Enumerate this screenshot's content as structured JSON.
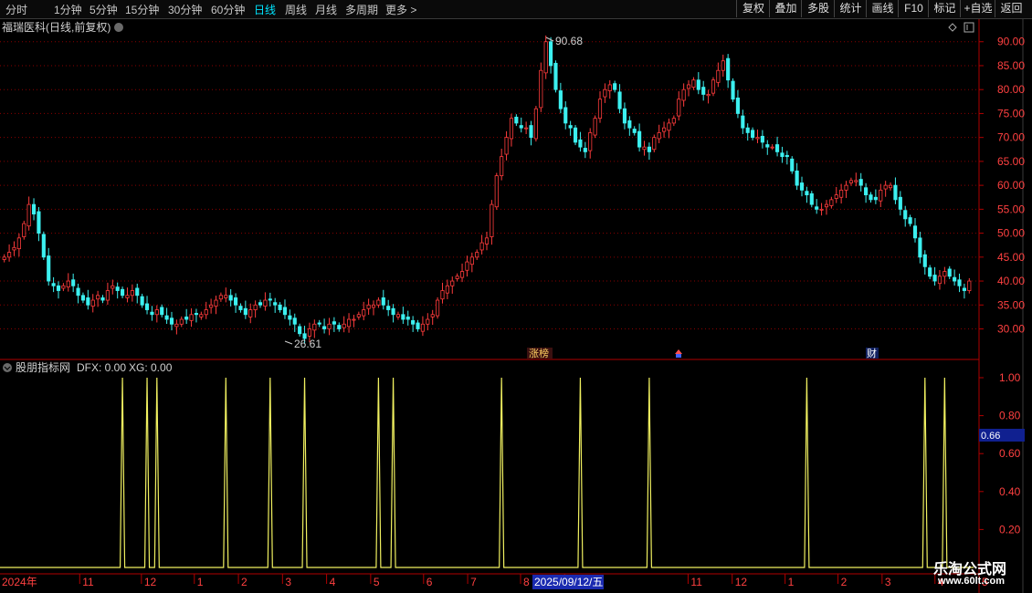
{
  "toolbar": {
    "periods": [
      "分时",
      "1分钟",
      "5分钟",
      "15分钟",
      "30分钟",
      "60分钟",
      "日线",
      "周线",
      "月线",
      "多周期",
      "更多 >"
    ],
    "active": "日线",
    "right_buttons": [
      "复权",
      "叠加",
      "多股",
      "统计",
      "画线",
      "F10",
      "标记",
      "+自选",
      "返回"
    ]
  },
  "main": {
    "title": "福瑞医科(日线,前复权)",
    "price_axis": [
      "90.00",
      "85.00",
      "80.00",
      "75.00",
      "70.00",
      "65.00",
      "60.00",
      "55.00",
      "50.00",
      "45.00",
      "40.00",
      "35.00",
      "30.00"
    ],
    "high_label": "90.68",
    "low_label": "26.61",
    "markers": [
      "涨榜",
      "财"
    ]
  },
  "indicator": {
    "title": "股朋指标网",
    "dfx_label": "DFX: 0.00",
    "xg_label": "XG: 0.00",
    "axis": [
      "1.00",
      "0.80",
      "0.60",
      "0.40",
      "0.20"
    ],
    "current_value": "0.66"
  },
  "date_axis": {
    "year_label": "2024年",
    "months": [
      "11",
      "12",
      "1",
      "2",
      "3",
      "4",
      "5",
      "6",
      "7",
      "8",
      "9",
      "11",
      "12",
      "1",
      "2",
      "3",
      "4",
      "5"
    ],
    "cursor_date": "2025/09/12/五"
  },
  "colors": {
    "up": "#ff3c3c",
    "down": "#3cf0f0",
    "signal": "#f0f060",
    "grid": "#8a0000",
    "accent": "#00e5ff"
  },
  "watermark": {
    "line1": "乐淘公式网",
    "line2": "www.60lt.com"
  },
  "chart_data": {
    "type": "candlestick",
    "ylim": [
      24,
      93
    ],
    "close": [
      45,
      46,
      47,
      49,
      52,
      56,
      54,
      50,
      45,
      40,
      39,
      38,
      39,
      40,
      39,
      37,
      36,
      35,
      36,
      37,
      36,
      38,
      39,
      38,
      37,
      37,
      38,
      37,
      35,
      34,
      33,
      34,
      33,
      32,
      31,
      31,
      32,
      32,
      33,
      33,
      33,
      34,
      35,
      36,
      37,
      37,
      36,
      35,
      34,
      33,
      34,
      35,
      35,
      36,
      36,
      35,
      34,
      33,
      32,
      31,
      29,
      28,
      30,
      31,
      31,
      30,
      31,
      31,
      30,
      31,
      32,
      32,
      33,
      34,
      35,
      35,
      36,
      35,
      34,
      33,
      33,
      32,
      32,
      31,
      30,
      31,
      32,
      33,
      36,
      38,
      39,
      40,
      41,
      42,
      44,
      45,
      46,
      48,
      49,
      56,
      62,
      66,
      70,
      74,
      73,
      72,
      72,
      70,
      76,
      84,
      90,
      85,
      80,
      76,
      73,
      72,
      69,
      68,
      67,
      71,
      74,
      78,
      80,
      81,
      80,
      76,
      73,
      72,
      71,
      68,
      68,
      67,
      70,
      71,
      72,
      73,
      74,
      78,
      80,
      81,
      82,
      80,
      79,
      79,
      82,
      84,
      86,
      82,
      78,
      75,
      72,
      71,
      70,
      70,
      69,
      68,
      68,
      67,
      66,
      66,
      63,
      60,
      59,
      58,
      56,
      55,
      55,
      56,
      57,
      58,
      59,
      60,
      61,
      61,
      60,
      58,
      57,
      57,
      59,
      60,
      60,
      57,
      55,
      53,
      52,
      49,
      45,
      43,
      41,
      40,
      41,
      42,
      41,
      40,
      39,
      38,
      40
    ],
    "highlight": {
      "max": 90.68,
      "min": 26.61
    },
    "signal_series": {
      "name": "DFX",
      "spike_dates_index": [
        24,
        29,
        31,
        45,
        54,
        61,
        76,
        79,
        101,
        117,
        131,
        163,
        187,
        191
      ]
    }
  }
}
